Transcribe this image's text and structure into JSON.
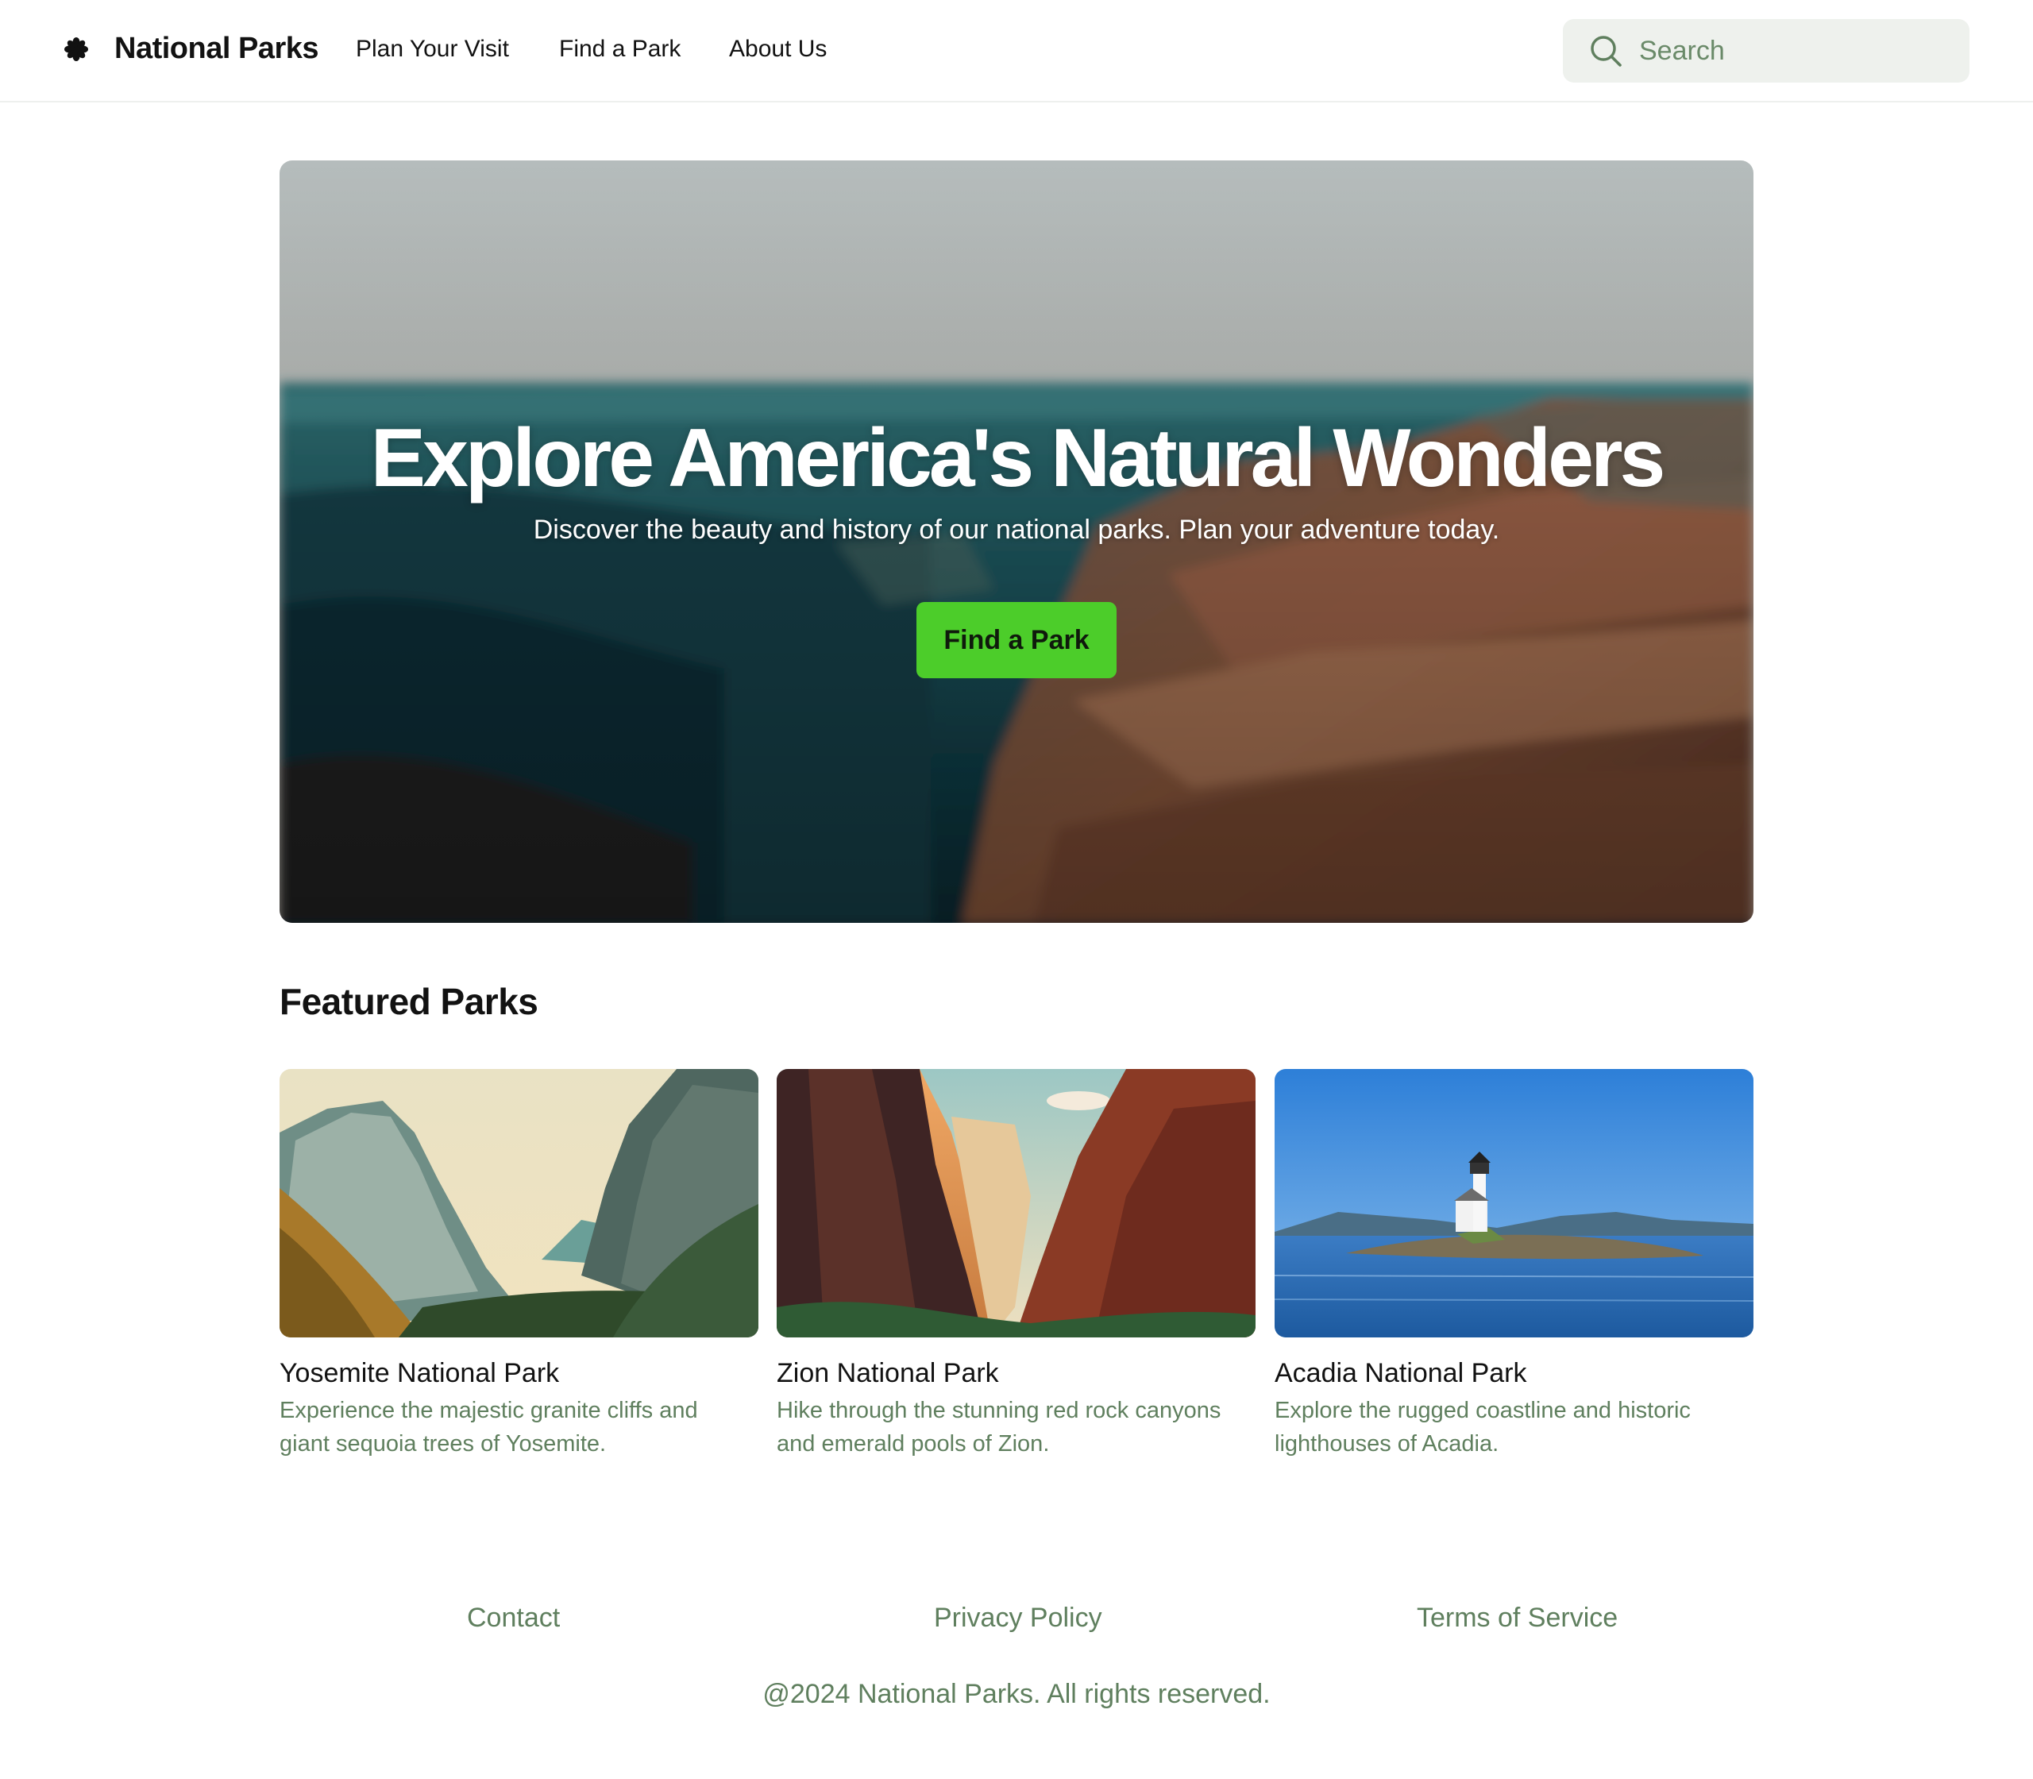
{
  "header": {
    "logo_icon": "asterisk-flower-icon",
    "brand": "National Parks",
    "nav": [
      "Plan Your Visit",
      "Find a Park",
      "About Us"
    ],
    "search": {
      "placeholder": "Search",
      "icon": "search-icon"
    }
  },
  "hero": {
    "title": "Explore America's Natural Wonders",
    "subtitle": "Discover the beauty and history of our national parks. Plan your adventure today.",
    "button": "Find a Park",
    "button_color": "#4ccd2a"
  },
  "featured": {
    "title": "Featured Parks",
    "parks": [
      {
        "name": "Yosemite National Park",
        "description": "Experience the majestic granite cliffs and giant sequoia trees of Yosemite."
      },
      {
        "name": "Zion National Park",
        "description": "Hike through the stunning red rock canyons and emerald pools of Zion."
      },
      {
        "name": "Acadia National Park",
        "description": "Explore the rugged coastline and historic lighthouses of Acadia."
      }
    ]
  },
  "footer": {
    "links": [
      "Contact",
      "Privacy Policy",
      "Terms of Service"
    ],
    "copyright": "@2024 National Parks. All rights reserved."
  },
  "colors": {
    "accent_green": "#4ccd2a",
    "muted_green_text": "#5f7f5e",
    "search_bg": "#eef1ed"
  }
}
